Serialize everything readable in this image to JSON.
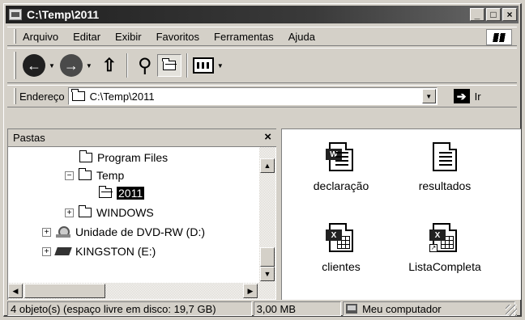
{
  "window": {
    "title": "C:\\Temp\\2011",
    "buttons": {
      "minimize": "_",
      "maximize": "□",
      "close": "×"
    }
  },
  "menu": [
    "Arquivo",
    "Editar",
    "Exibir",
    "Favoritos",
    "Ferramentas",
    "Ajuda"
  ],
  "toolbar": {
    "back_glyph": "←",
    "forward_glyph": "→",
    "drop_glyph": "▼",
    "up_glyph": "⇧",
    "search_glyph": "⚲"
  },
  "address": {
    "label": "Endereço",
    "value": "C:\\Temp\\2011",
    "go_label": "Ir",
    "go_glyph": "➔"
  },
  "folders_pane": {
    "title": "Pastas",
    "close_glyph": "×",
    "tree": [
      {
        "label": "Program Files",
        "expander": ""
      },
      {
        "label": "Temp",
        "expander": "−"
      },
      {
        "label": "2011",
        "expander": "",
        "selected": true
      },
      {
        "label": "WINDOWS",
        "expander": "+"
      },
      {
        "label": "Unidade de DVD-RW (D:)",
        "expander": "+"
      },
      {
        "label": "KINGSTON (E:)",
        "expander": "+"
      }
    ]
  },
  "scroll_glyphs": {
    "up": "▲",
    "down": "▼",
    "left": "◀",
    "right": "▶"
  },
  "files": [
    {
      "name": "declaração",
      "type": "word",
      "badge": "W"
    },
    {
      "name": "resultados",
      "type": "text"
    },
    {
      "name": "clientes",
      "type": "excel",
      "badge": "X"
    },
    {
      "name": "ListaCompleta",
      "type": "excel-shortcut",
      "badge": "X",
      "shortcut_glyph": "↗"
    }
  ],
  "status": {
    "objects": "4 objeto(s) (espaço livre em disco: 19,7 GB)",
    "size": "3,00 MB",
    "location": "Meu computador"
  }
}
